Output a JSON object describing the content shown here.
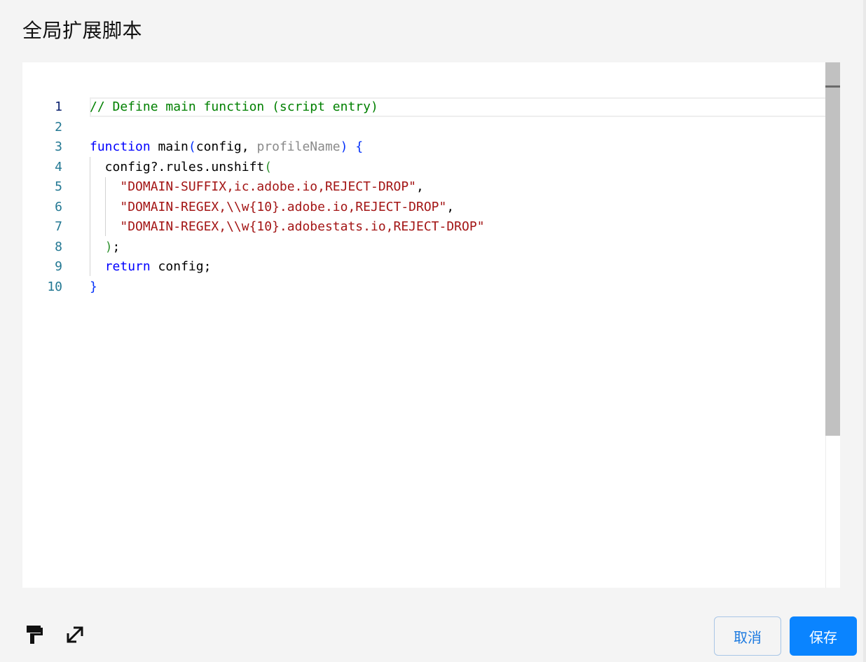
{
  "dialog": {
    "title": "全局扩展脚本"
  },
  "editor": {
    "language": "javascript",
    "active_line": 1,
    "line_numbers": [
      "1",
      "2",
      "3",
      "4",
      "5",
      "6",
      "7",
      "8",
      "9",
      "10"
    ],
    "lines": [
      [
        {
          "t": "// Define main function (script entry)",
          "k": "comment"
        }
      ],
      [],
      [
        {
          "t": "function",
          "k": "keyword"
        },
        {
          "t": " main",
          "k": "ident"
        },
        {
          "t": "(",
          "k": "bracket1"
        },
        {
          "t": "config, ",
          "k": "ident"
        },
        {
          "t": "profileName",
          "k": "param"
        },
        {
          "t": ")",
          "k": "bracket1"
        },
        {
          "t": " ",
          "k": "ident"
        },
        {
          "t": "{",
          "k": "bracket1"
        }
      ],
      [
        {
          "t": "  config?.rules.unshift",
          "k": "ident"
        },
        {
          "t": "(",
          "k": "bracket2"
        }
      ],
      [
        {
          "t": "    ",
          "k": "ident"
        },
        {
          "t": "\"DOMAIN-SUFFIX,ic.adobe.io,REJECT-DROP\"",
          "k": "string"
        },
        {
          "t": ",",
          "k": "ident"
        }
      ],
      [
        {
          "t": "    ",
          "k": "ident"
        },
        {
          "t": "\"DOMAIN-REGEX,\\\\w{10}.adobe.io,REJECT-DROP\"",
          "k": "string"
        },
        {
          "t": ",",
          "k": "ident"
        }
      ],
      [
        {
          "t": "    ",
          "k": "ident"
        },
        {
          "t": "\"DOMAIN-REGEX,\\\\w{10}.adobestats.io,REJECT-DROP\"",
          "k": "string"
        }
      ],
      [
        {
          "t": "  ",
          "k": "ident"
        },
        {
          "t": ")",
          "k": "bracket2"
        },
        {
          "t": ";",
          "k": "ident"
        }
      ],
      [
        {
          "t": "  ",
          "k": "ident"
        },
        {
          "t": "return",
          "k": "keyword"
        },
        {
          "t": " config;",
          "k": "ident"
        }
      ],
      [
        {
          "t": "}",
          "k": "bracket1"
        }
      ]
    ],
    "colors": {
      "comment": "#008000",
      "keyword": "#0000ff",
      "string": "#a31515",
      "param": "#8a8a8a",
      "line_number": "#237893"
    }
  },
  "toolbar": {
    "format_icon": "paint-roller-icon",
    "expand_icon": "expand-arrows-icon"
  },
  "actions": {
    "cancel_label": "取消",
    "save_label": "保存",
    "accent_color": "#0a84ff"
  }
}
